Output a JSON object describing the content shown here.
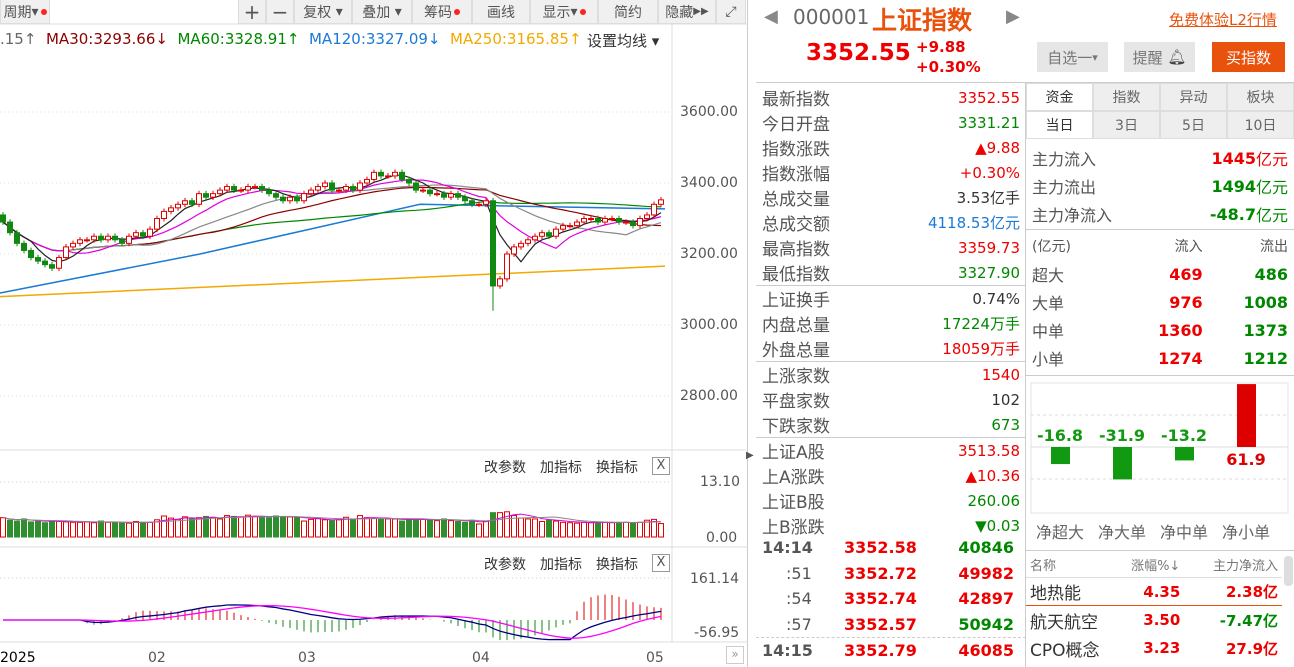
{
  "toolbar": {
    "period": "周期",
    "plus": "+",
    "minus": "−",
    "fuquan": "复权",
    "diejia": "叠加",
    "chouma": "筹码",
    "huaxian": "画线",
    "xianshi": "显示",
    "jianyue": "简约",
    "yincang": "隐藏"
  },
  "ma": {
    "prev": ".15",
    "ma30": "MA30:3293.66",
    "ma60": "MA60:3328.91",
    "ma120": "MA120:3327.09",
    "ma250": "MA250:3165.85",
    "setting": "设置均线"
  },
  "price_axis": [
    "3600.00",
    "3400.00",
    "3200.00",
    "3000.00",
    "2800.00"
  ],
  "panel_actions": {
    "edit": "改参数",
    "add": "加指标",
    "swap": "换指标",
    "close": "X"
  },
  "vol_axis": [
    "13.10",
    "0.00"
  ],
  "macd_axis": [
    "161.14",
    "-56.95"
  ],
  "date_axis": [
    "2025",
    "02",
    "03",
    "04",
    "05"
  ],
  "colors": {
    "up": "#e00000",
    "down": "#118811",
    "ma5": "#555555",
    "ma10": "#e000e0",
    "ma20": "#7a0000",
    "ma30": "#8b0000",
    "ma60": "#008800",
    "ma120": "#1a7ad6",
    "ma250": "#f2a900",
    "accent": "#e8520c"
  },
  "chart": {
    "closes": [
      3290,
      3260,
      3230,
      3210,
      3190,
      3180,
      3170,
      3160,
      3190,
      3220,
      3230,
      3240,
      3240,
      3250,
      3240,
      3250,
      3240,
      3230,
      3250,
      3260,
      3250,
      3270,
      3300,
      3320,
      3330,
      3340,
      3350,
      3340,
      3370,
      3360,
      3370,
      3380,
      3390,
      3380,
      3380,
      3390,
      3390,
      3380,
      3370,
      3360,
      3350,
      3360,
      3350,
      3370,
      3380,
      3390,
      3400,
      3380,
      3380,
      3390,
      3380,
      3400,
      3410,
      3430,
      3420,
      3420,
      3430,
      3410,
      3400,
      3380,
      3380,
      3370,
      3370,
      3360,
      3370,
      3360,
      3350,
      3340,
      3340,
      3350,
      3110,
      3130,
      3200,
      3220,
      3230,
      3240,
      3250,
      3260,
      3250,
      3270,
      3280,
      3280,
      3290,
      3300,
      3300,
      3290,
      3300,
      3300,
      3290,
      3290,
      3280,
      3300,
      3310,
      3340,
      3352.55
    ],
    "volumes": [
      4.6,
      4.0,
      3.8,
      4.3,
      3.6,
      3.8,
      3.4,
      3.9,
      3.8,
      3.6,
      3.5,
      3.5,
      3.6,
      3.4,
      3.8,
      3.5,
      3.5,
      3.3,
      3.3,
      3.7,
      3.5,
      3.5,
      4.1,
      5.0,
      4.5,
      4.2,
      4.8,
      4.3,
      4.6,
      4.9,
      4.7,
      4.3,
      5.1,
      4.9,
      4.8,
      5.2,
      4.9,
      4.9,
      4.6,
      5.0,
      4.9,
      4.8,
      4.6,
      3.8,
      4.2,
      4.4,
      4.1,
      3.9,
      4.1,
      4.7,
      4.3,
      5.1,
      4.6,
      4.4,
      4.2,
      4.3,
      4.3,
      3.8,
      4.2,
      4.3,
      4.2,
      4.1,
      3.9,
      4.3,
      3.9,
      3.7,
      3.5,
      4.0,
      3.1,
      3.8,
      5.8,
      5.8,
      6.0,
      5.1,
      4.5,
      4.3,
      4.3,
      3.7,
      4.0,
      3.8,
      3.5,
      3.4,
      3.3,
      3.5,
      3.4,
      3.5,
      3.5,
      3.4,
      3.5,
      3.5,
      3.3,
      3.5,
      4.0,
      4.2,
      3.2
    ],
    "ma120": [
      3090,
      3327
    ],
    "ma250": [
      3080,
      3165.85
    ],
    "price_range": [
      2700,
      3700
    ],
    "vol_max": 13.1
  },
  "header": {
    "code": "000001",
    "name": "上证指数",
    "l2": "免费体验L2行情",
    "price": "3352.55",
    "change": "+9.88",
    "pct": "+0.30%",
    "watch": "自选一",
    "alert": "提醒",
    "buy": "买指数"
  },
  "stats": [
    {
      "k": "最新指数",
      "v": "3352.55",
      "c": "red"
    },
    {
      "k": "今日开盘",
      "v": "3331.21",
      "c": "green"
    },
    {
      "k": "指数涨跌",
      "v": "▲9.88",
      "c": "red"
    },
    {
      "k": "指数涨幅",
      "v": "+0.30%",
      "c": "red"
    },
    {
      "k": "总成交量",
      "v": "3.53亿手",
      "c": "gray"
    },
    {
      "k": "总成交额",
      "v": "4118.53亿元",
      "c": "blue"
    },
    {
      "k": "最高指数",
      "v": "3359.73",
      "c": "red"
    },
    {
      "k": "最低指数",
      "v": "3327.90",
      "c": "green"
    },
    {
      "k": "上证换手",
      "v": "0.74%",
      "c": "gray"
    },
    {
      "k": "内盘总量",
      "v": "17224万手",
      "c": "green"
    },
    {
      "k": "外盘总量",
      "v": "18059万手",
      "c": "red"
    },
    {
      "k": "上涨家数",
      "v": "1540",
      "c": "red"
    },
    {
      "k": "平盘家数",
      "v": "102",
      "c": "gray"
    },
    {
      "k": "下跌家数",
      "v": "673",
      "c": "green"
    },
    {
      "k": "上证A股",
      "v": "3513.58",
      "c": "red"
    },
    {
      "k": "上A涨跌",
      "v": "▲10.36",
      "c": "red"
    },
    {
      "k": "上证B股",
      "v": "260.06",
      "c": "green"
    },
    {
      "k": "上B涨跌",
      "v": "▼0.03",
      "c": "green"
    }
  ],
  "ticks": [
    {
      "t": "14:14",
      "p": "3352.58",
      "v": "40846",
      "vc": "green"
    },
    {
      "t": ":51",
      "p": "3352.72",
      "v": "49982",
      "vc": "red"
    },
    {
      "t": ":54",
      "p": "3352.74",
      "v": "42897",
      "vc": "red"
    },
    {
      "t": ":57",
      "p": "3352.57",
      "v": "50942",
      "vc": "green"
    },
    {
      "t": "14:15",
      "p": "3352.79",
      "v": "46085",
      "vc": "red"
    }
  ],
  "tabs1": [
    "资金",
    "指数",
    "异动",
    "板块"
  ],
  "tabs2": [
    "当日",
    "3日",
    "5日",
    "10日"
  ],
  "flows": [
    {
      "k": "主力流入",
      "v": "1445",
      "u": "亿元",
      "c": "red"
    },
    {
      "k": "主力流出",
      "v": "1494",
      "u": "亿元",
      "c": "green"
    },
    {
      "k": "主力净流入",
      "v": "-48.7",
      "u": "亿元",
      "c": "green"
    }
  ],
  "flow_table": {
    "headers": [
      "(亿元)",
      "流入",
      "流出"
    ],
    "rows": [
      [
        "超大",
        "469",
        "486"
      ],
      [
        "大单",
        "976",
        "1008"
      ],
      [
        "中单",
        "1360",
        "1373"
      ],
      [
        "小单",
        "1274",
        "1212"
      ]
    ]
  },
  "net_chart": {
    "labels": [
      "净超大",
      "净大单",
      "净中单",
      "净小单"
    ],
    "values": [
      -16.8,
      -31.9,
      -13.2,
      61.9
    ],
    "display": [
      "-16.8",
      "-31.9",
      "-13.2",
      "61.9"
    ]
  },
  "sectors": {
    "headers": [
      "名称",
      "涨幅%↓",
      "主力净流入"
    ],
    "rows": [
      {
        "n": "地热能",
        "p": "4.35",
        "f": "2.38亿",
        "fc": "red"
      },
      {
        "n": "航天航空",
        "p": "3.50",
        "f": "-7.47亿",
        "fc": "green"
      },
      {
        "n": "CPO概念",
        "p": "3.23",
        "f": "27.9亿",
        "fc": "red"
      }
    ]
  }
}
